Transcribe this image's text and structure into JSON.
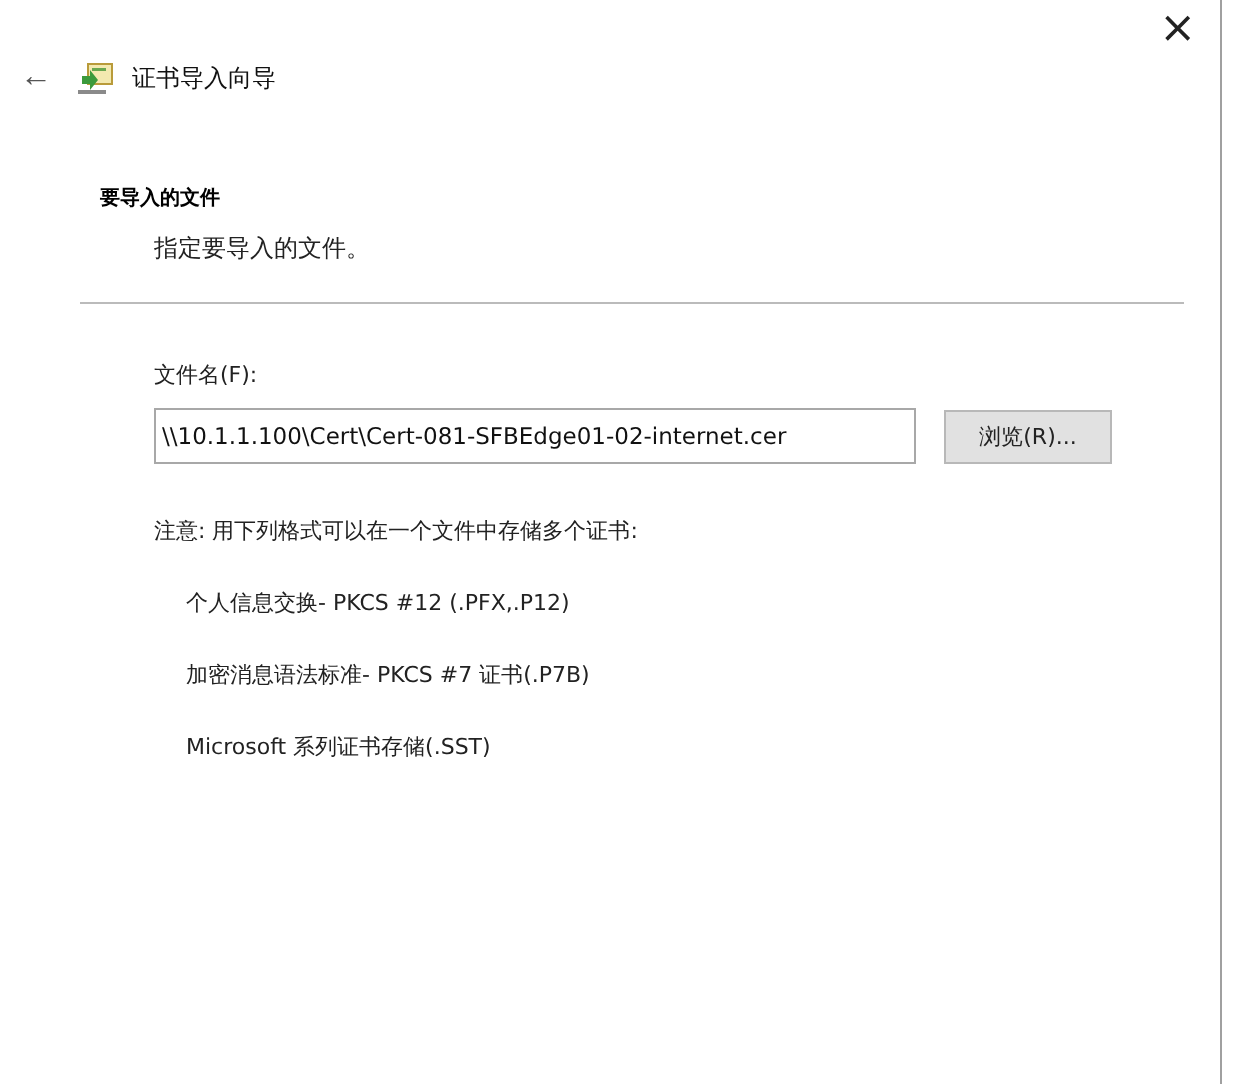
{
  "window": {
    "title": "证书导入向导",
    "close": "×",
    "back": "←"
  },
  "page": {
    "heading": "要导入的文件",
    "subtitle": "指定要导入的文件。"
  },
  "file_field": {
    "label": "文件名(F):",
    "value": "\\\\10.1.1.100\\Cert\\Cert-081-SFBEdge01-02-internet.cer",
    "button": "浏览(R)..."
  },
  "note": "注意: 用下列格式可以在一个文件中存储多个证书:",
  "formats": [
    "个人信息交换- PKCS #12 (.PFX,.P12)",
    "加密消息语法标准- PKCS #7 证书(.P7B)",
    "Microsoft 系列证书存储(.SST)"
  ]
}
